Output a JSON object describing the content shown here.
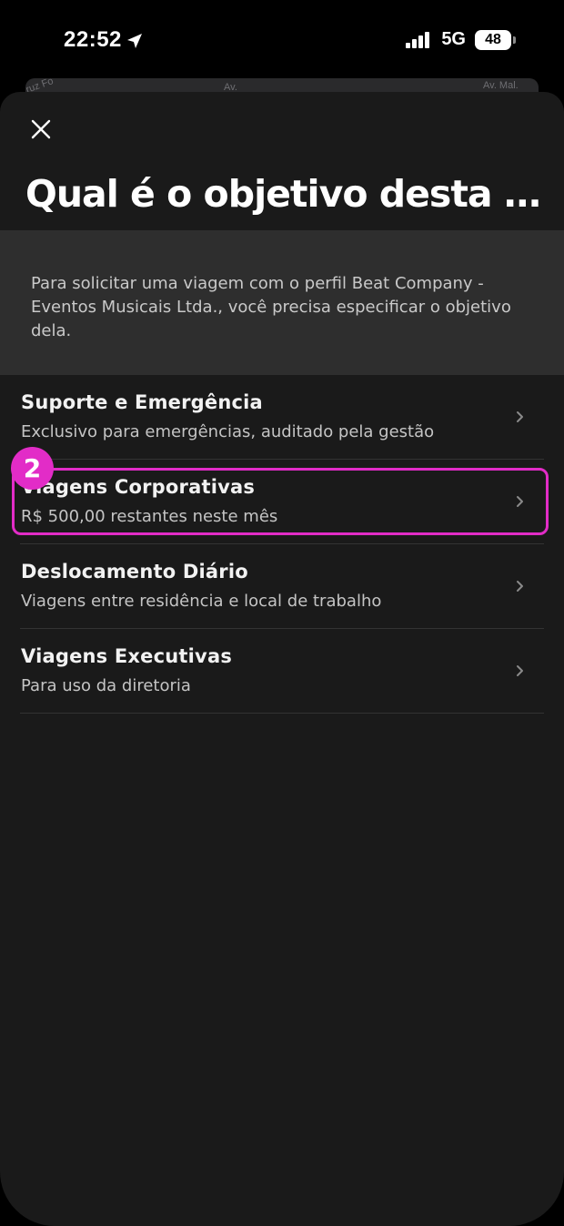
{
  "status_bar": {
    "time": "22:52",
    "network": "5G",
    "battery_level": "48"
  },
  "map_strip": {
    "labels": [
      "ruz Fo",
      "Av.",
      "Av. Mal."
    ]
  },
  "sheet": {
    "title": "Qual é o objetivo desta viag...",
    "info_text": "Para solicitar uma viagem com o perfil Beat Company - Eventos Musicais Ltda., você precisa especificar o objetivo dela.",
    "options": [
      {
        "title": "Suporte e Emergência",
        "subtitle": "Exclusivo para emergências, auditado pela gestão"
      },
      {
        "title": "Viagens Corporativas",
        "subtitle": "R$ 500,00 restantes neste mês"
      },
      {
        "title": "Deslocamento Diário",
        "subtitle": "Viagens entre residência e local de trabalho"
      },
      {
        "title": "Viagens Executivas",
        "subtitle": "Para uso da diretoria"
      }
    ]
  },
  "annotation": {
    "step_number": "2",
    "color": "#e22cc7"
  },
  "colors": {
    "background": "#000000",
    "sheet": "#1a1a1a",
    "info_box": "#2e2e2e",
    "accent": "#e22cc7"
  },
  "icons": [
    "location-arrow-icon",
    "signal-bars-icon",
    "battery-icon",
    "close-icon",
    "chevron-right-icon"
  ]
}
